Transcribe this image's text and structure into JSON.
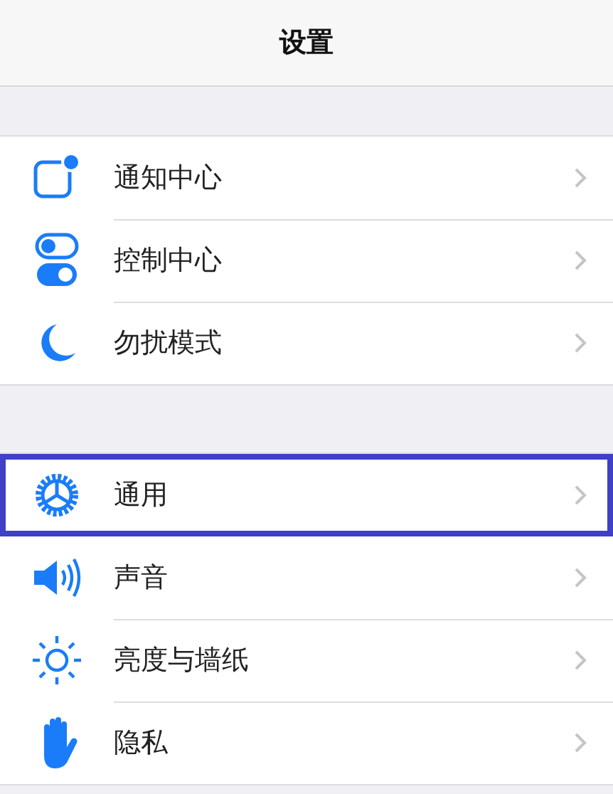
{
  "nav_bar": {
    "title": "设置"
  },
  "groups": [
    {
      "items": [
        {
          "kind": "notifications",
          "label": "通知中心",
          "highlighted": false
        },
        {
          "kind": "control",
          "label": "控制中心",
          "highlighted": false
        },
        {
          "kind": "moon",
          "label": "勿扰模式",
          "highlighted": false
        }
      ]
    },
    {
      "items": [
        {
          "kind": "gear",
          "label": "通用",
          "highlighted": true
        },
        {
          "kind": "sound",
          "label": "声音",
          "highlighted": false
        },
        {
          "kind": "sun",
          "label": "亮度与墙纸",
          "highlighted": false
        },
        {
          "kind": "hand",
          "label": "隐私",
          "highlighted": false
        }
      ]
    }
  ]
}
